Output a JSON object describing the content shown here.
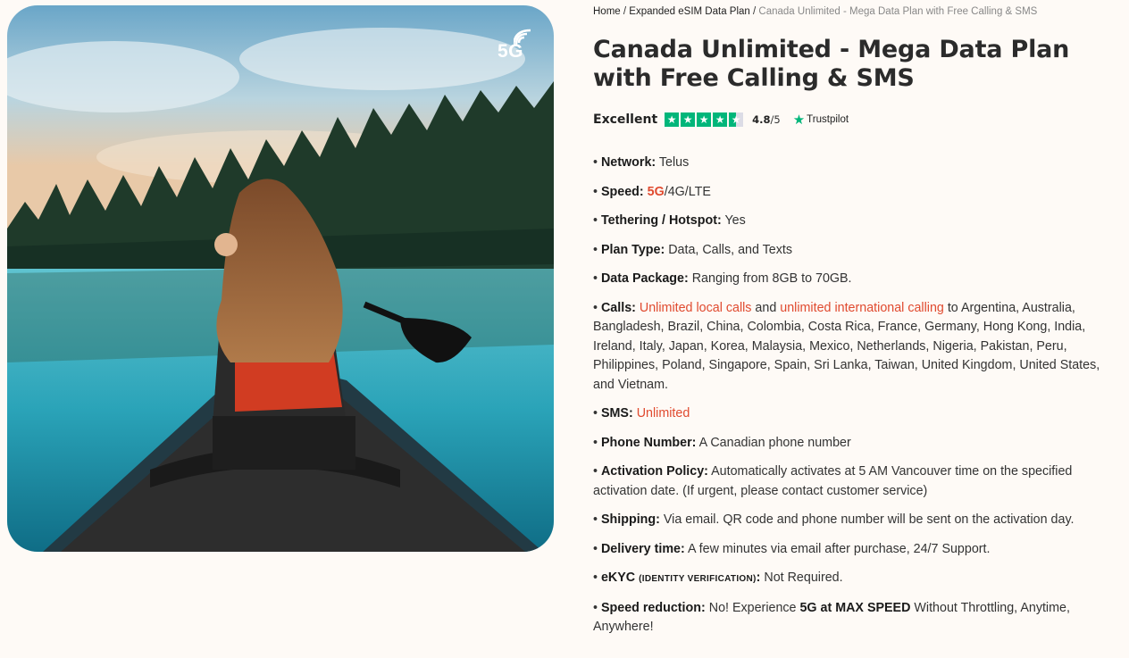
{
  "breadcrumb": {
    "home": "Home",
    "sep1": " / ",
    "parent": "Expanded eSIM Data Plan",
    "sep2": " / ",
    "current": "Canada Unlimited - Mega Data Plan with Free Calling & SMS"
  },
  "product": {
    "title": "Canada Unlimited - Mega Data Plan with Free Calling & SMS",
    "image_badge": "5G"
  },
  "rating": {
    "label": "Excellent",
    "score": "4.8",
    "out_of": "/5",
    "stars": 4.5,
    "source": "Trustpilot"
  },
  "specs": {
    "network": {
      "key": "Network:",
      "value": "Telus"
    },
    "speed": {
      "key": "Speed:",
      "highlight": "5G",
      "rest": "/4G/LTE"
    },
    "tethering": {
      "key": "Tethering / Hotspot:",
      "value": "Yes"
    },
    "plan_type": {
      "key": "Plan Type:",
      "value": "Data, Calls, and Texts"
    },
    "data_package": {
      "key": "Data Package:",
      "value": "Ranging from 8GB to 70GB."
    },
    "calls": {
      "key": "Calls:",
      "local": "Unlimited local calls",
      "and": " and ",
      "intl": "unlimited international calling",
      "rest": " to Argentina, Australia, Bangladesh, Brazil, China, Colombia, Costa Rica, France, Germany, Hong Kong, India, Ireland, Italy, Japan, Korea, Malaysia, Mexico, Netherlands, Nigeria, Pakistan, Peru, Philippines, Poland, Singapore, Spain, Sri Lanka, Taiwan, United Kingdom, United States, and Vietnam."
    },
    "sms": {
      "key": "SMS:",
      "value": "Unlimited"
    },
    "phone_number": {
      "key": "Phone Number:",
      "value": "A Canadian phone number"
    },
    "activation": {
      "key": "Activation Policy:",
      "value": "Automatically activates at 5 AM Vancouver time on the specified activation date. (If urgent, please contact customer service)"
    },
    "shipping": {
      "key": "Shipping:",
      "value": "Via email. QR code and phone number will be sent on the activation day."
    },
    "delivery": {
      "key": "Delivery time:",
      "value": "A few minutes via email after purchase, 24/7 Support."
    },
    "ekyc": {
      "key": "eKYC",
      "sub": "(IDENTITY VERIFICATION)",
      "colon": ":",
      "value": "Not Required."
    },
    "speed_reduction": {
      "key": "Speed reduction:",
      "pre": "No! Experience ",
      "bold": "5G at MAX SPEED",
      "post": " Without Throttling, Anytime, Anywhere!"
    }
  },
  "colors": {
    "accent_red": "#e04a2f",
    "trustpilot_green": "#00b67a",
    "page_bg": "#fefaf6"
  }
}
